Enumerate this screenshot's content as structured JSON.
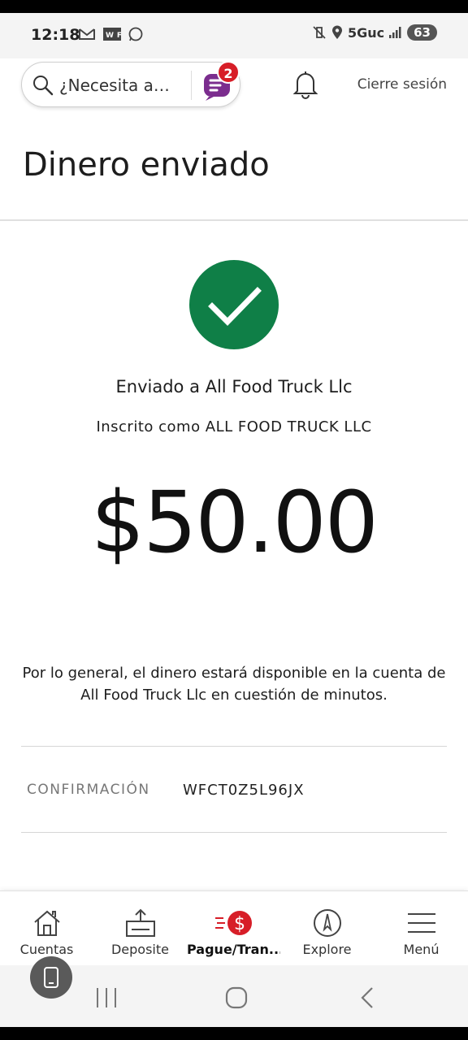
{
  "status_bar": {
    "time": "12:18",
    "left_icons": [
      "gmail-icon",
      "wf-icon",
      "whatsapp-icon"
    ],
    "network": "5Guc",
    "battery": "63"
  },
  "header": {
    "search_placeholder": "¿Necesita a…",
    "notification_count": "2",
    "logout_label": "Cierre sesión"
  },
  "page": {
    "title": "Dinero enviado"
  },
  "confirmation": {
    "sent_to": "Enviado a All Food Truck Llc",
    "enrolled_as": "Inscrito como ALL FOOD TRUCK LLC",
    "amount": "$50.00",
    "availability_note": "Por lo general, el dinero estará disponible en la cuenta de All Food Truck Llc en cuestión de minutos.",
    "confirmation_label": "CONFIRMACIÓN",
    "confirmation_number": "WFCT0Z5L96JX"
  },
  "bottom_nav": {
    "items": [
      {
        "label": "Cuentas",
        "icon": "home-icon"
      },
      {
        "label": "Deposite",
        "icon": "deposit-icon"
      },
      {
        "label": "Pague/Tran...",
        "icon": "pay-transfer-icon",
        "active": true
      },
      {
        "label": "Explore",
        "icon": "compass-icon"
      },
      {
        "label": "Menú",
        "icon": "hamburger-menu-icon"
      }
    ]
  },
  "colors": {
    "success_green": "#0f7f47",
    "brand_red": "#d71e28",
    "brand_purple": "#7b2d8e"
  }
}
